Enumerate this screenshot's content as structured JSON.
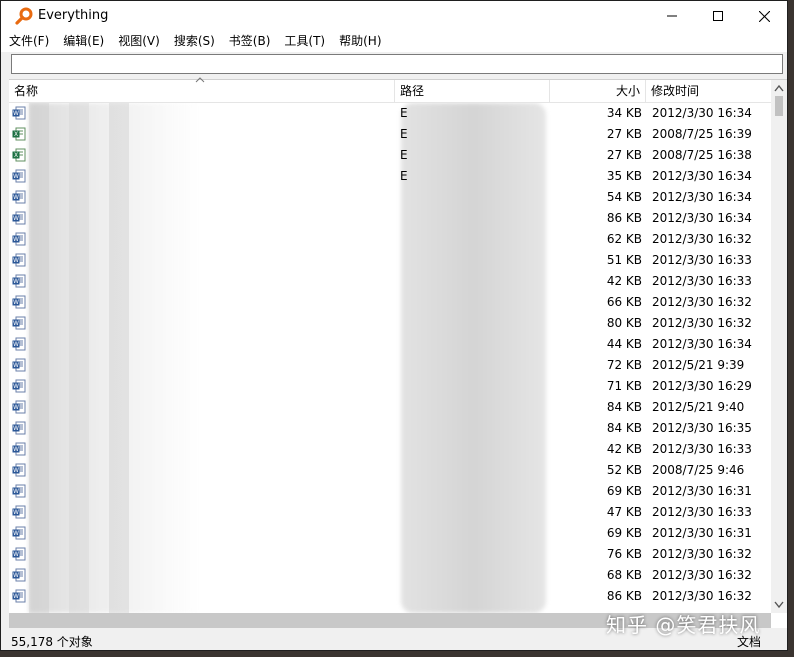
{
  "window": {
    "title": "Everything",
    "accent": "#e86a10"
  },
  "menu": [
    "文件(F)",
    "编辑(E)",
    "视图(V)",
    "搜索(S)",
    "书签(B)",
    "工具(T)",
    "帮助(H)"
  ],
  "search": {
    "value": "",
    "placeholder": ""
  },
  "columns": {
    "name": "名称",
    "path": "路径",
    "size": "大小",
    "modified": "修改时间"
  },
  "rows": [
    {
      "icon": "word-doc-icon",
      "path": "E",
      "size": "34 KB",
      "modified": "2012/3/30 16:34"
    },
    {
      "icon": "excel-sheet-icon",
      "path": "E",
      "size": "27 KB",
      "modified": "2008/7/25 16:39"
    },
    {
      "icon": "excel-sheet-icon",
      "path": "E",
      "size": "27 KB",
      "modified": "2008/7/25 16:38"
    },
    {
      "icon": "word-doc-icon",
      "path": "E",
      "size": "35 KB",
      "modified": "2012/3/30 16:34"
    },
    {
      "icon": "word-doc-icon",
      "path": "",
      "size": "54 KB",
      "modified": "2012/3/30 16:34"
    },
    {
      "icon": "word-doc-icon",
      "path": "",
      "size": "86 KB",
      "modified": "2012/3/30 16:34"
    },
    {
      "icon": "word-doc-icon",
      "path": "",
      "size": "62 KB",
      "modified": "2012/3/30 16:32"
    },
    {
      "icon": "word-doc-icon",
      "path": "",
      "size": "51 KB",
      "modified": "2012/3/30 16:33"
    },
    {
      "icon": "word-doc-icon",
      "path": "",
      "size": "42 KB",
      "modified": "2012/3/30 16:33"
    },
    {
      "icon": "word-doc-icon",
      "path": "",
      "size": "66 KB",
      "modified": "2012/3/30 16:32"
    },
    {
      "icon": "word-doc-icon",
      "path": "",
      "size": "80 KB",
      "modified": "2012/3/30 16:32"
    },
    {
      "icon": "word-doc-icon",
      "path": "",
      "size": "44 KB",
      "modified": "2012/3/30 16:34"
    },
    {
      "icon": "word-doc-icon",
      "path": "",
      "size": "72 KB",
      "modified": "2012/5/21 9:39"
    },
    {
      "icon": "word-doc-icon",
      "path": "",
      "size": "71 KB",
      "modified": "2012/3/30 16:29"
    },
    {
      "icon": "word-doc-icon",
      "path": "",
      "size": "84 KB",
      "modified": "2012/5/21 9:40"
    },
    {
      "icon": "word-doc-icon",
      "path": "",
      "size": "84 KB",
      "modified": "2012/3/30 16:35"
    },
    {
      "icon": "word-doc-icon",
      "path": "",
      "size": "42 KB",
      "modified": "2012/3/30 16:33"
    },
    {
      "icon": "word-doc-icon",
      "path": "",
      "size": "52 KB",
      "modified": "2008/7/25 9:46"
    },
    {
      "icon": "word-doc-icon",
      "path": "",
      "size": "69 KB",
      "modified": "2012/3/30 16:31"
    },
    {
      "icon": "word-doc-icon",
      "path": "",
      "size": "47 KB",
      "modified": "2012/3/30 16:33"
    },
    {
      "icon": "word-doc-icon",
      "path": "",
      "size": "69 KB",
      "modified": "2012/3/30 16:31"
    },
    {
      "icon": "word-doc-icon",
      "path": "",
      "size": "76 KB",
      "modified": "2012/3/30 16:32"
    },
    {
      "icon": "word-doc-icon",
      "path": "",
      "size": "68 KB",
      "modified": "2012/3/30 16:32"
    },
    {
      "icon": "word-doc-icon",
      "path": "",
      "size": "86 KB",
      "modified": "2012/3/30 16:32"
    }
  ],
  "status": {
    "count": "55,178 个对象",
    "filter": "文档"
  },
  "watermark": "知乎 @笑君扶风"
}
